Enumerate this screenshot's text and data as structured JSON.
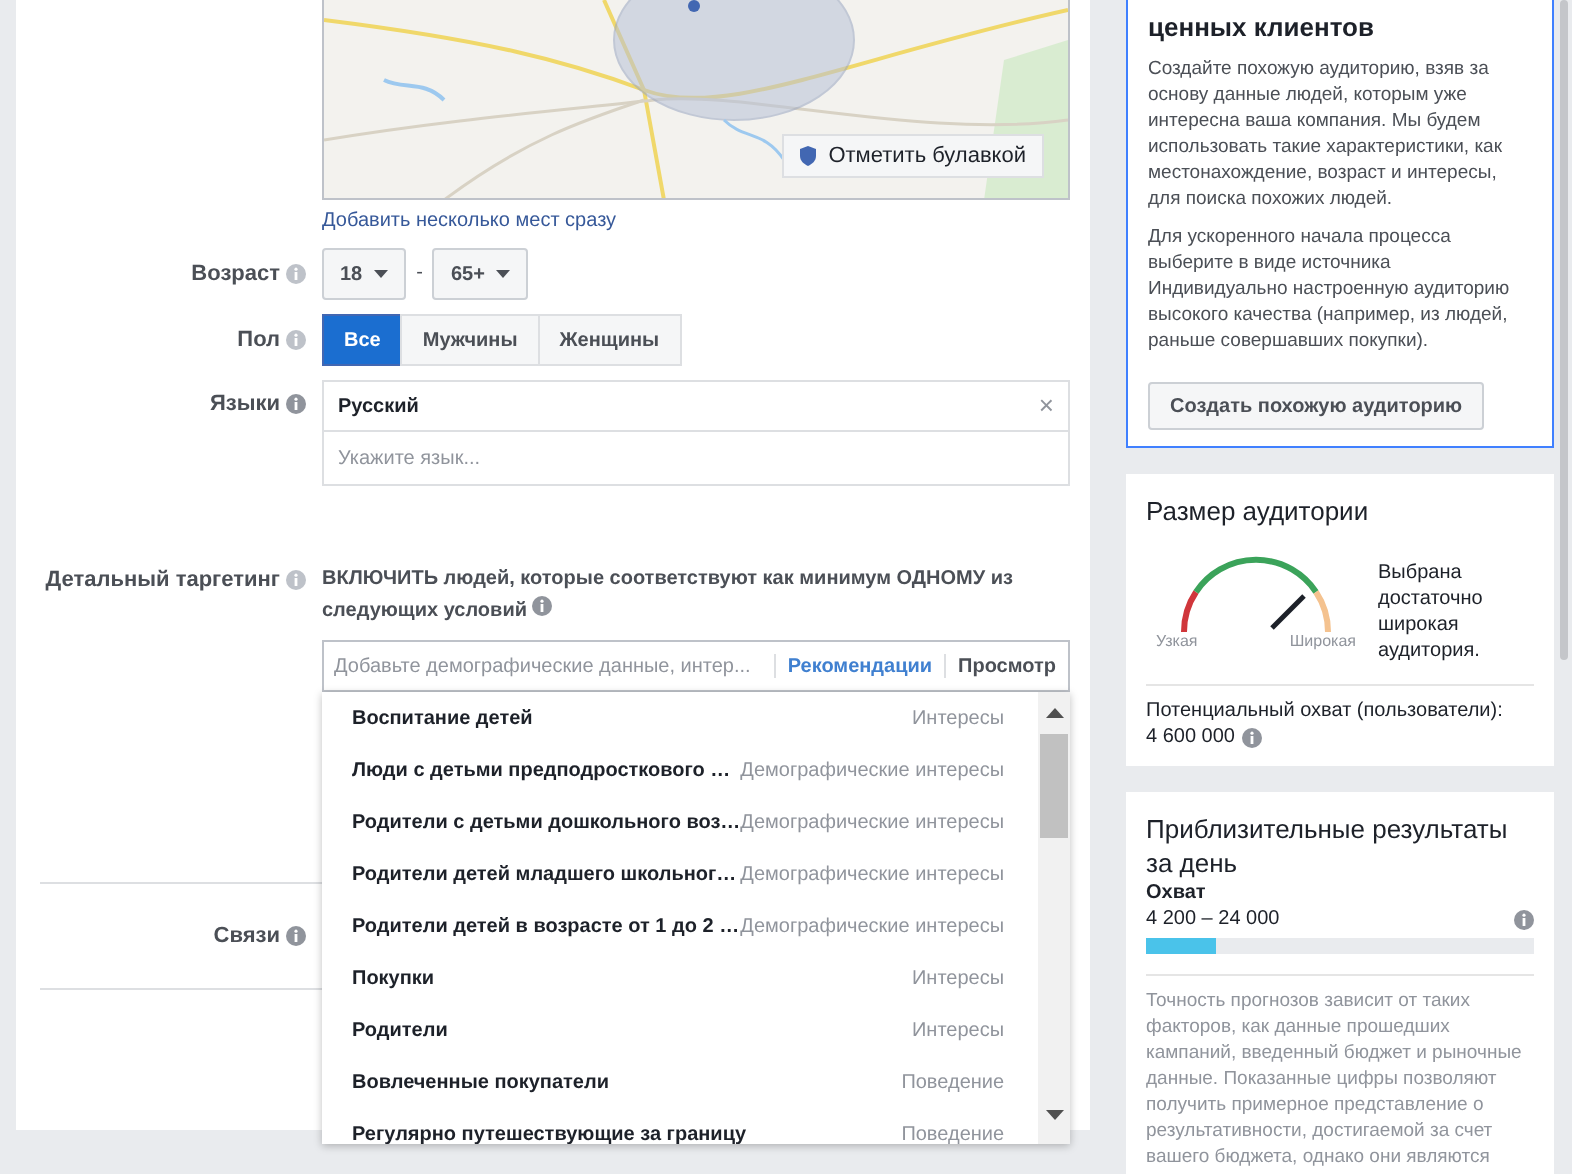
{
  "location": {
    "pin_button": "Отметить булавкой",
    "add_link": "Добавить несколько мест сразу"
  },
  "age": {
    "label": "Возраст",
    "from": "18",
    "separator": "-",
    "to": "65+"
  },
  "gender": {
    "label": "Пол",
    "options": [
      {
        "label": "Все",
        "selected": true
      },
      {
        "label": "Мужчины",
        "selected": false
      },
      {
        "label": "Женщины",
        "selected": false
      }
    ]
  },
  "languages": {
    "label": "Языки",
    "tags": [
      "Русский"
    ],
    "remove": "×",
    "placeholder": "Укажите язык..."
  },
  "detailed_targeting": {
    "label": "Детальный таргетинг",
    "description": "ВКЛЮЧИТЬ людей, которые соответствуют как минимум ОДНОМУ из следующих условий",
    "placeholder": "Добавьте демографические данные, интер...",
    "recommendations": "Рекомендации",
    "browse": "Просмотр",
    "suggestions": [
      {
        "name": "Воспитание детей",
        "category": "Интересы"
      },
      {
        "name": "Люди с детьми предподросткового …",
        "category": "Демографические интересы"
      },
      {
        "name": "Родители с детьми дошкольного воз…",
        "category": "Демографические интересы"
      },
      {
        "name": "Родители детей младшего школьног…",
        "category": "Демографические интересы"
      },
      {
        "name": "Родители детей в возрасте от 1 до 2 …",
        "category": "Демографические интересы"
      },
      {
        "name": "Покупки",
        "category": "Интересы"
      },
      {
        "name": "Родители",
        "category": "Интересы"
      },
      {
        "name": "Вовлеченные покупатели",
        "category": "Поведение"
      },
      {
        "name": "Регулярно путешествующие за границу",
        "category": "Поведение"
      }
    ]
  },
  "connections": {
    "label": "Связи"
  },
  "lookalike_card": {
    "title": "ценных клиентов",
    "paragraphs": [
      "Создайте похожую аудиторию, взяв за основу данные людей, которым уже интересна ваша компания. Мы будем использовать такие характеристики, как местонахождение, возраст и интересы, для поиска похожих людей.",
      "Для ускоренного начала процесса выберите в виде источника Индивидуально настроенную аудиторию высокого качества (например, из людей, раньше совершавших покупки)."
    ],
    "button": "Создать похожую аудиторию"
  },
  "audience_size": {
    "title": "Размер аудитории",
    "narrow": "Узкая",
    "broad": "Широкая",
    "verdict": "Выбрана достаточно широкая аудитория.",
    "reach_label": "Потенциальный охват (пользователи):",
    "reach_value": "4 600 000"
  },
  "daily_results": {
    "title": "Приблизительные результаты за день",
    "metric": "Охват",
    "range": "4 200 – 24 000",
    "level": 0.18,
    "note": "Точность прогнозов зависит от таких факторов, как данные прошедших кампаний, введенный бюджет и рыночные данные. Показанные цифры позволяют получить примерное представление о результативности, достигаемой за счет вашего бюджета, однако они являются"
  }
}
